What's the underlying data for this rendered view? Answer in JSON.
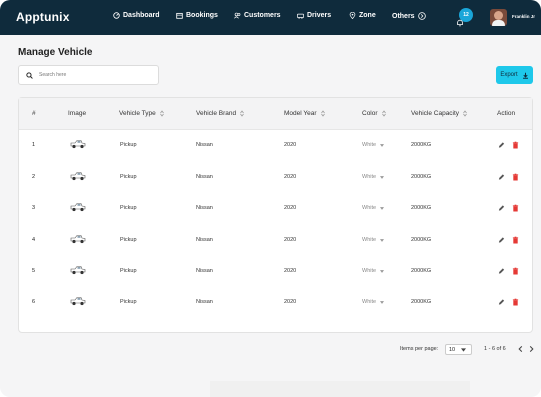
{
  "app": {
    "logo": "Apptunix"
  },
  "nav": {
    "items": [
      {
        "label": "Dashboard",
        "icon": "dashboard-icon"
      },
      {
        "label": "Bookings",
        "icon": "bookings-icon"
      },
      {
        "label": "Customers",
        "icon": "customers-icon"
      },
      {
        "label": "Drivers",
        "icon": "drivers-icon"
      },
      {
        "label": "Zone",
        "icon": "location-pin-icon"
      },
      {
        "label": "Others",
        "icon": "chevron-circle-icon"
      }
    ],
    "notification_count": "12",
    "username": "Franklin Jr"
  },
  "page": {
    "title": "Manage Vehicle"
  },
  "search": {
    "placeholder": "Search here"
  },
  "toolbar": {
    "export_label": "Export"
  },
  "table": {
    "headers": {
      "num": "#",
      "image": "Image",
      "type": "Vehicle Type",
      "brand": "Vehicle Brand",
      "year": "Model Year",
      "color": "Color",
      "capacity": "Vehicle Capacity",
      "action": "Action"
    },
    "rows": [
      {
        "num": "1",
        "type": "Pickup",
        "brand": "Nissan",
        "year": "2020",
        "color": "White",
        "capacity": "2000KG"
      },
      {
        "num": "2",
        "type": "Pickup",
        "brand": "Nissan",
        "year": "2020",
        "color": "White",
        "capacity": "2000KG"
      },
      {
        "num": "3",
        "type": "Pickup",
        "brand": "Nissan",
        "year": "2020",
        "color": "White",
        "capacity": "2000KG"
      },
      {
        "num": "4",
        "type": "Pickup",
        "brand": "Nissan",
        "year": "2020",
        "color": "White",
        "capacity": "2000KG"
      },
      {
        "num": "5",
        "type": "Pickup",
        "brand": "Nissan",
        "year": "2020",
        "color": "White",
        "capacity": "2000KG"
      },
      {
        "num": "6",
        "type": "Pickup",
        "brand": "Nissan",
        "year": "2020",
        "color": "White",
        "capacity": "2000KG"
      }
    ]
  },
  "pagination": {
    "items_per_page_label": "Items per page:",
    "items_per_page_value": "10",
    "range": "1 - 6 of 6"
  },
  "colors": {
    "navbar": "#0f2b3c",
    "accent": "#1ec8ea",
    "delete": "#e53935"
  }
}
